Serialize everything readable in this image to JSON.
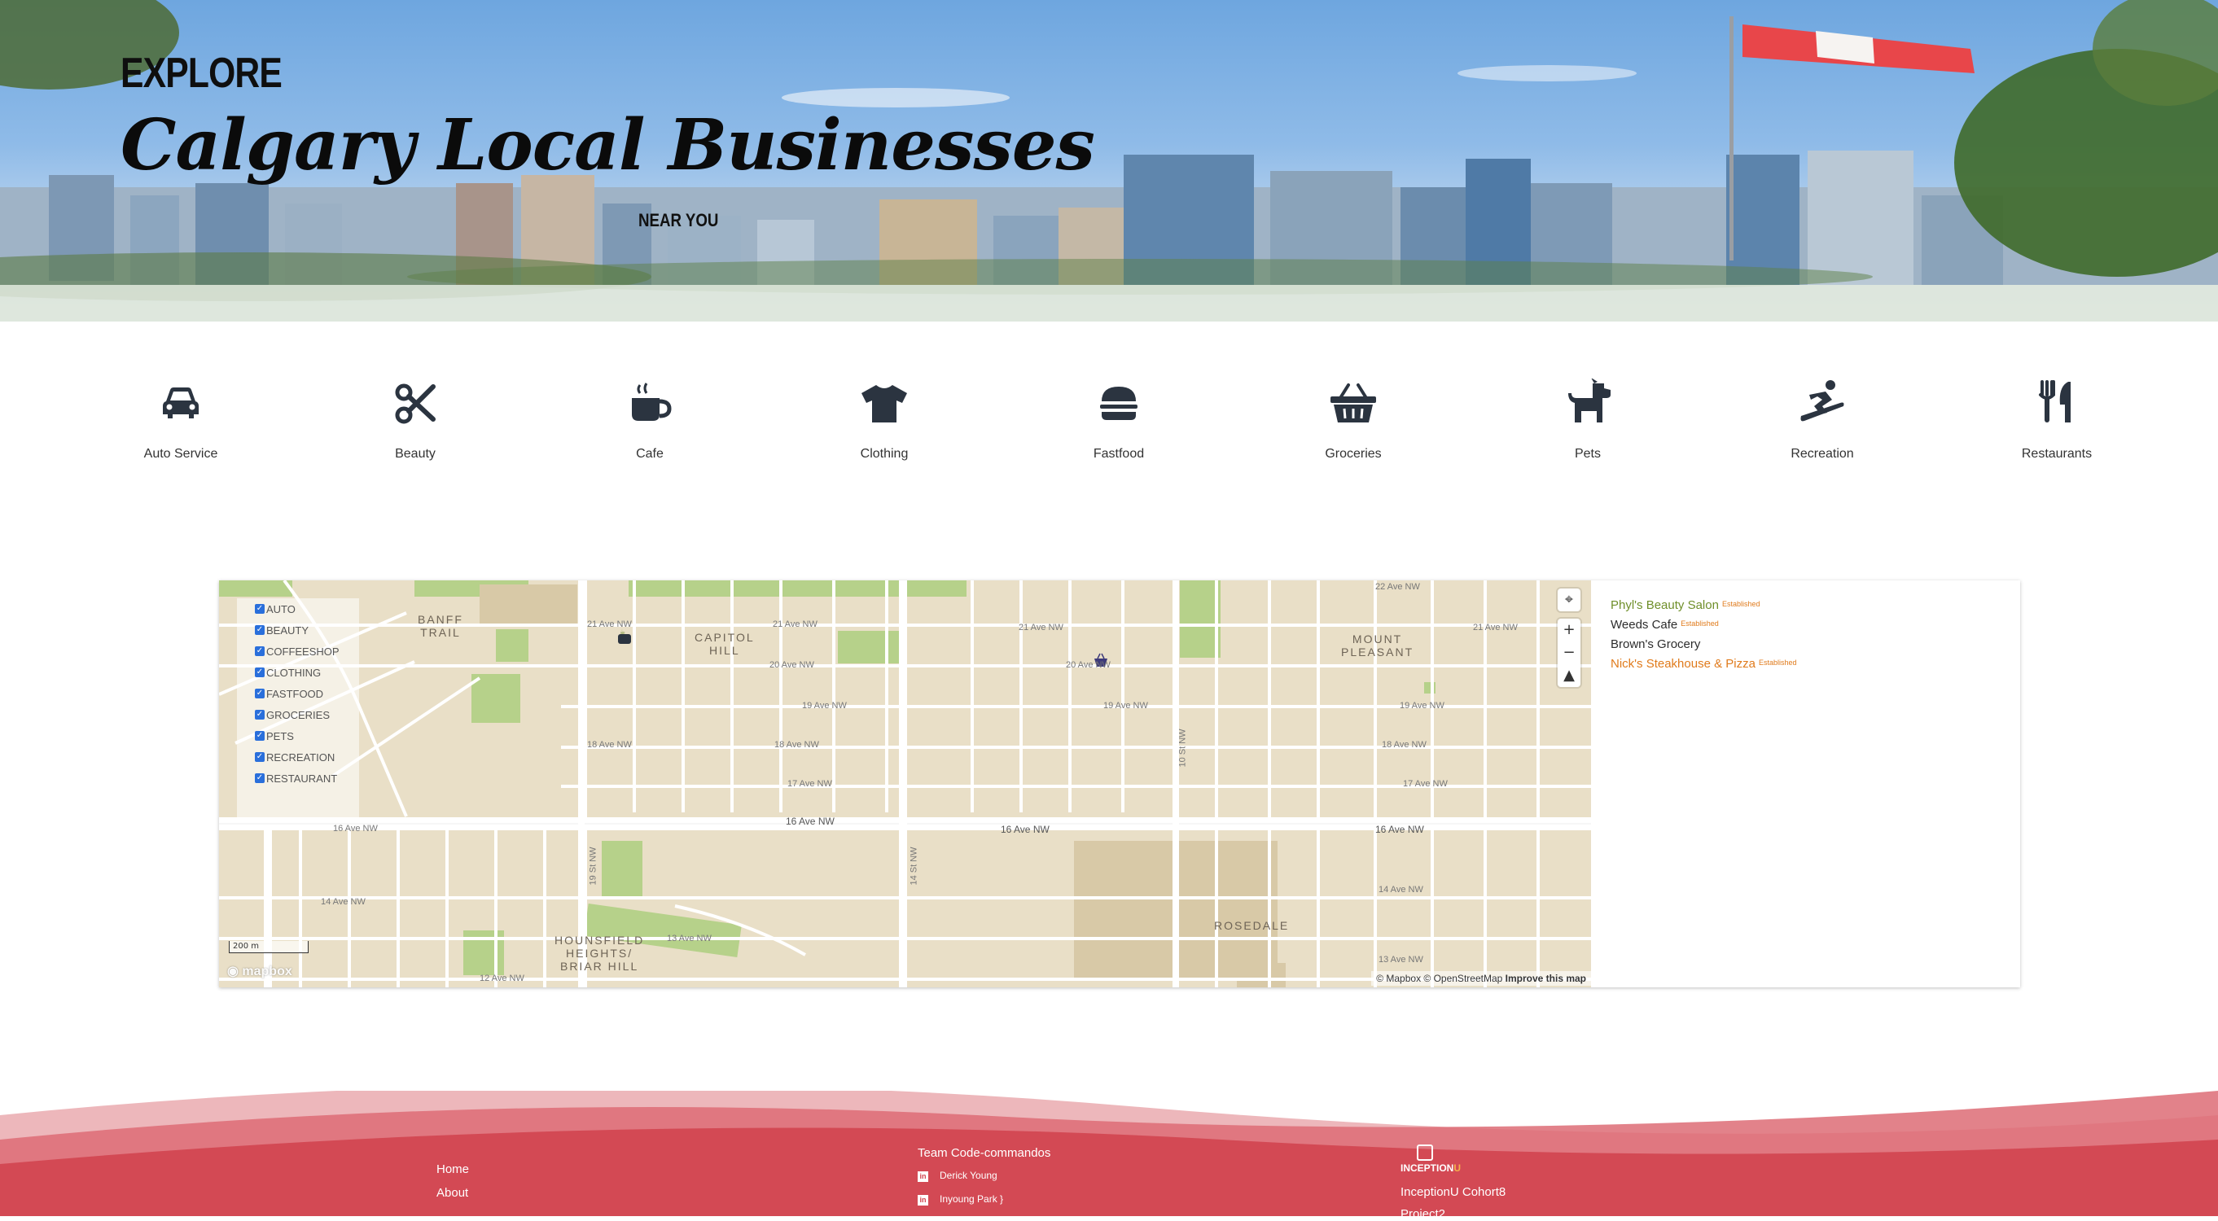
{
  "hero": {
    "kicker": "EXPLORE",
    "title": "Calgary Local Businesses",
    "subtitle": "NEAR YOU"
  },
  "categories": [
    {
      "label": "Auto Service",
      "icon": "car-icon"
    },
    {
      "label": "Beauty",
      "icon": "scissors-icon"
    },
    {
      "label": "Cafe",
      "icon": "coffee-cup-icon"
    },
    {
      "label": "Clothing",
      "icon": "tshirt-icon"
    },
    {
      "label": "Fastfood",
      "icon": "burger-icon"
    },
    {
      "label": "Groceries",
      "icon": "basket-icon"
    },
    {
      "label": "Pets",
      "icon": "dog-icon"
    },
    {
      "label": "Recreation",
      "icon": "snowboard-icon"
    },
    {
      "label": "Restaurants",
      "icon": "utensils-icon"
    }
  ],
  "map": {
    "filters": [
      "AUTO",
      "BEAUTY",
      "COFFEESHOP",
      "CLOTHING",
      "FASTFOOD",
      "GROCERIES",
      "PETS",
      "RECREATION",
      "RESTAURANT"
    ],
    "neighbourhoods": {
      "banff_trail": [
        "BANFF",
        "TRAIL"
      ],
      "capitol_hill": [
        "CAPITOL",
        "HILL"
      ],
      "mount_pleasant": [
        "MOUNT",
        "PLEASANT"
      ],
      "rosedale": [
        "ROSEDALE"
      ],
      "hounsfield": [
        "HOUNSFIELD",
        "HEIGHTS/",
        "BRIAR HILL"
      ]
    },
    "streets": {
      "ave16": "16 Ave NW",
      "ave20": "20 Ave NW",
      "ave21": "21 Ave NW",
      "ave22": "22 Ave NW",
      "ave19": "19 Ave NW",
      "ave18": "18 Ave NW",
      "ave17": "17 Ave NW",
      "ave14": "14 Ave NW",
      "ave13": "13 Ave NW",
      "ave12": "12 Ave NW",
      "st19": "19 St NW",
      "st14": "14 St NW",
      "st10": "10 St NW"
    },
    "scale_label": "200 m",
    "logo_text": "mapbox",
    "attribution_prefix": "© Mapbox © OpenStreetMap",
    "attribution_link": "Improve this map",
    "controls": [
      "locate-icon",
      "zoom-in-icon",
      "zoom-out-icon",
      "compass-icon"
    ]
  },
  "businesses": [
    {
      "name": "Phyl's Beauty Salon",
      "tag": "Established",
      "color": "#6f8f2a"
    },
    {
      "name": "Weeds Cafe",
      "tag": "Established",
      "color": "#2d2d2d"
    },
    {
      "name": "Brown's Grocery",
      "tag": "",
      "color": "#2d2d2d"
    },
    {
      "name": "Nick's Steakhouse & Pizza",
      "tag": "Established",
      "color": "#e07b1c"
    }
  ],
  "footer": {
    "links": [
      "Home",
      "About"
    ],
    "team_title": "Team Code-commandos",
    "members": [
      "Derick Young",
      "Inyoung Park"
    ],
    "brand": {
      "part1": "INCEPTION",
      "part2": "U"
    },
    "cohort": "InceptionU Cohort8",
    "project": "Project2"
  },
  "colors": {
    "icon": "#2b3440",
    "footer_red": "#d2444f",
    "footer_pink": "#e9a5aa",
    "map_land": "#e9dfc7",
    "map_park": "#b6d18a"
  }
}
